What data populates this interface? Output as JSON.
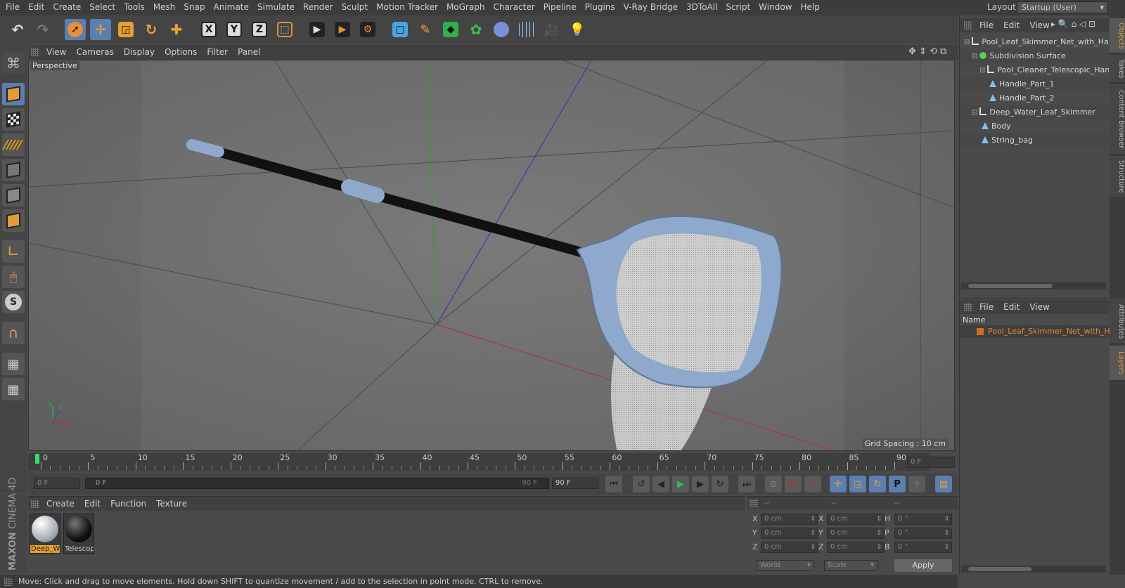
{
  "menubar": {
    "items": [
      "File",
      "Edit",
      "Create",
      "Select",
      "Tools",
      "Mesh",
      "Snap",
      "Animate",
      "Simulate",
      "Render",
      "Sculpt",
      "Motion Tracker",
      "MoGraph",
      "Character",
      "Pipeline",
      "Plugins",
      "V-Ray Bridge",
      "3DToAll",
      "Script",
      "Window",
      "Help"
    ],
    "layout_label": "Layout:",
    "layout_value": "Startup (User)"
  },
  "viewport": {
    "menu": [
      "View",
      "Cameras",
      "Display",
      "Options",
      "Filter",
      "Panel"
    ],
    "label": "Perspective",
    "grid_spacing": "Grid Spacing : 10 cm"
  },
  "objects_panel": {
    "menu": [
      "File",
      "Edit",
      "View"
    ],
    "tree": [
      {
        "name": "Pool_Leaf_Skimmer_Net_with_Hand",
        "icon": "null",
        "indent": 0
      },
      {
        "name": "Subdivision Surface",
        "icon": "subdiv",
        "indent": 1
      },
      {
        "name": "Pool_Cleaner_Telescopic_Hand",
        "icon": "null",
        "indent": 2
      },
      {
        "name": "Handle_Part_1",
        "icon": "poly",
        "indent": 3
      },
      {
        "name": "Handle_Part_2",
        "icon": "poly",
        "indent": 3
      },
      {
        "name": "Deep_Water_Leaf_Skimmer",
        "icon": "null",
        "indent": 1
      },
      {
        "name": "Body",
        "icon": "poly",
        "indent": 2
      },
      {
        "name": "String_bag",
        "icon": "poly",
        "indent": 2
      }
    ]
  },
  "side_tabs": {
    "top": [
      "Objects",
      "Takes",
      "Content Browser",
      "Structure"
    ],
    "bottom": [
      "Attributes",
      "Layers"
    ]
  },
  "layers_panel": {
    "menu": [
      "File",
      "Edit",
      "View"
    ],
    "column": "Name",
    "item": "Pool_Leaf_Skimmer_Net_with_Han",
    "item_color": "#d86a1e"
  },
  "timeline": {
    "ticks": [
      "0",
      "5",
      "10",
      "15",
      "20",
      "25",
      "30",
      "35",
      "40",
      "45",
      "50",
      "55",
      "60",
      "65",
      "70",
      "75",
      "80",
      "85",
      "90"
    ],
    "current_frame": "0 F",
    "start_frame": "0 F",
    "slider_start": "0 F",
    "slider_end": "90 F",
    "end_frame": "90 F"
  },
  "materials": {
    "menu": [
      "Create",
      "Edit",
      "Function",
      "Texture"
    ],
    "items": [
      {
        "name": "Deep_W",
        "selected": true
      },
      {
        "name": "Telescop",
        "selected": false
      }
    ]
  },
  "coords": {
    "headers": [
      "--",
      "--",
      "--"
    ],
    "rows": [
      {
        "a": "X",
        "av": "0 cm",
        "b": "X",
        "bv": "0 cm",
        "c": "H",
        "cv": "0 °"
      },
      {
        "a": "Y",
        "av": "0 cm",
        "b": "Y",
        "bv": "0 cm",
        "c": "P",
        "cv": "0 °"
      },
      {
        "a": "Z",
        "av": "0 cm",
        "b": "Z",
        "bv": "0 cm",
        "c": "B",
        "cv": "0 °"
      }
    ],
    "world": "World",
    "scale": "Scale",
    "apply": "Apply"
  },
  "status": "Move: Click and drag to move elements. Hold down SHIFT to quantize movement / add to the selection in point mode, CTRL to remove.",
  "brand": {
    "maxon": "MAXON",
    "c4d": "CINEMA 4D"
  }
}
